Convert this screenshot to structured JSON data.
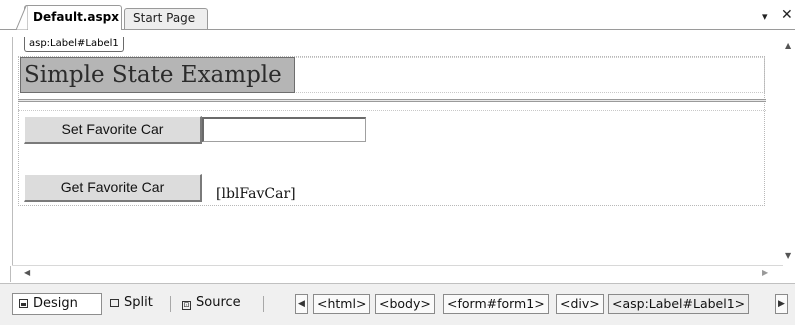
{
  "tabs": [
    {
      "label": "Default.aspx",
      "active": true
    },
    {
      "label": "Start Page",
      "active": false
    }
  ],
  "window_controls": {
    "dropdown_icon": "▾",
    "close_icon": "✕"
  },
  "designer": {
    "smart_tag": "asp:Label#Label1",
    "title_label": "Simple State Example",
    "set_button": "Set Favorite Car",
    "get_button": "Get Favorite Car",
    "textbox_value": "",
    "fav_car_label": "[lblFavCar]"
  },
  "view_modes": [
    {
      "label": "Design",
      "icon": "design-icon",
      "selected": true
    },
    {
      "label": "Split",
      "icon": "split-icon",
      "selected": false
    },
    {
      "label": "Source",
      "icon": "source-icon",
      "selected": false
    }
  ],
  "breadcrumbs": [
    "<html>",
    "<body>",
    "<form#form1>",
    "<div>",
    "<asp:Label#Label1>"
  ],
  "colors": {
    "label_background": "#b5b5b5",
    "button_face": "#dcdcdc",
    "bar_background": "#f0f0f0"
  }
}
